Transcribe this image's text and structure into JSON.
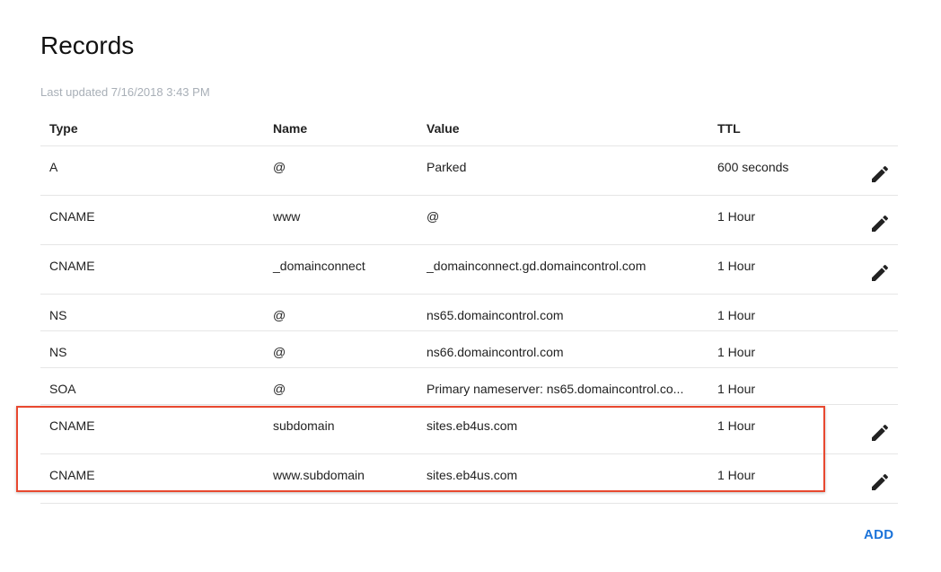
{
  "page": {
    "title": "Records",
    "last_updated": "Last updated 7/16/2018 3:43 PM"
  },
  "table": {
    "headers": {
      "type": "Type",
      "name": "Name",
      "value": "Value",
      "ttl": "TTL"
    },
    "rows": [
      {
        "type": "A",
        "name": "@",
        "value": "Parked",
        "ttl": "600 seconds",
        "editable": true
      },
      {
        "type": "CNAME",
        "name": "www",
        "value": "@",
        "ttl": "1 Hour",
        "editable": true
      },
      {
        "type": "CNAME",
        "name": "_domainconnect",
        "value": "_domainconnect.gd.domaincontrol.com",
        "ttl": "1 Hour",
        "editable": true
      },
      {
        "type": "NS",
        "name": "@",
        "value": "ns65.domaincontrol.com",
        "ttl": "1 Hour",
        "editable": false
      },
      {
        "type": "NS",
        "name": "@",
        "value": "ns66.domaincontrol.com",
        "ttl": "1 Hour",
        "editable": false
      },
      {
        "type": "SOA",
        "name": "@",
        "value": "Primary nameserver: ns65.domaincontrol.co...",
        "ttl": "1 Hour",
        "editable": false
      },
      {
        "type": "CNAME",
        "name": "subdomain",
        "value": "sites.eb4us.com",
        "ttl": "1 Hour",
        "editable": true
      },
      {
        "type": "CNAME",
        "name": "www.subdomain",
        "value": "sites.eb4us.com",
        "ttl": "1 Hour",
        "editable": true
      }
    ]
  },
  "actions": {
    "add_label": "ADD",
    "edit_icon": "pencil-icon"
  },
  "colors": {
    "accent": "#1b73d9",
    "highlight_border": "#e8482f",
    "muted_text": "#a8afb7",
    "divider": "#e6e6e6"
  }
}
